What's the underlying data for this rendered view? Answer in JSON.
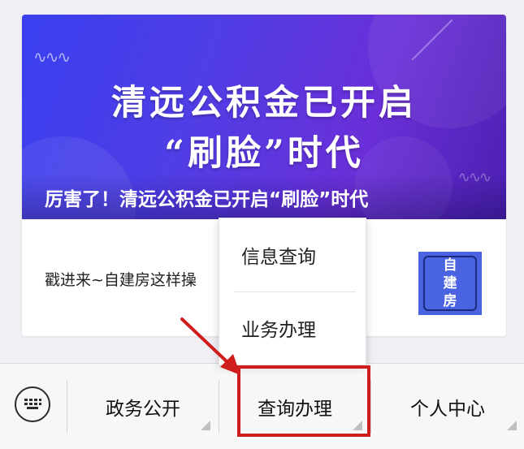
{
  "article_card": {
    "banner": {
      "title_line1": "清远公积金已开启",
      "title_line2": "“刷脸”时代",
      "caption": "厉害了！清远公积金已开启“刷脸”时代"
    },
    "second_article": {
      "text": "戳进来~自建房这样操",
      "thumbnail_chars": [
        "自",
        "建",
        "房"
      ]
    }
  },
  "popup_menu": {
    "items": [
      {
        "label": "信息查询"
      },
      {
        "label": "业务办理"
      }
    ]
  },
  "bottom_menu": {
    "keyboard_icon": "keyboard-icon",
    "tabs": [
      {
        "label": "政务公开"
      },
      {
        "label": "查询办理"
      },
      {
        "label": "个人中心"
      }
    ]
  },
  "annotation": {
    "highlight_color": "#cf1d1d"
  }
}
